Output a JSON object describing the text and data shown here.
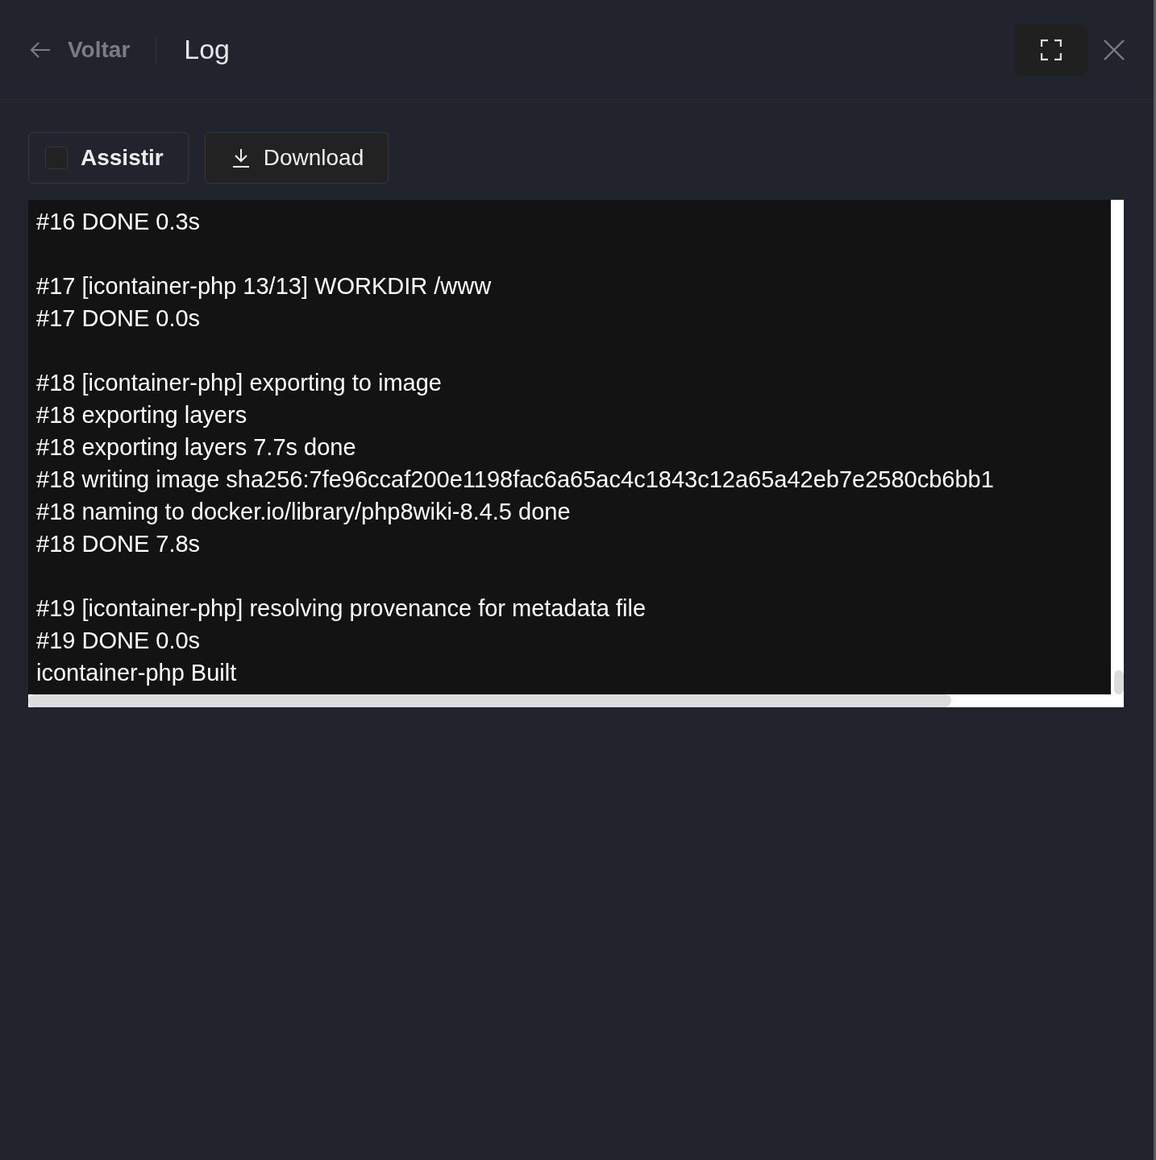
{
  "header": {
    "back_label": "Voltar",
    "title": "Log"
  },
  "toolbar": {
    "watch": {
      "label": "Assistir",
      "checked": false
    },
    "download_label": "Download"
  },
  "log": {
    "blocks": [
      [
        "#16 DONE 0.3s"
      ],
      [
        "#17 [icontainer-php 13/13] WORKDIR /www",
        "#17 DONE 0.0s"
      ],
      [
        "#18 [icontainer-php] exporting to image",
        "#18 exporting layers",
        "#18 exporting layers 7.7s done",
        "#18 writing image sha256:7fe96ccaf200e1198fac6a65ac4c1843c12a65a42eb7e2580cb6bb1",
        "#18 naming to docker.io/library/php8wiki-8.4.5 done",
        "#18 DONE 7.8s"
      ],
      [
        "#19 [icontainer-php] resolving provenance for metadata file",
        "#19 DONE 0.0s",
        "icontainer-php Built"
      ]
    ]
  }
}
